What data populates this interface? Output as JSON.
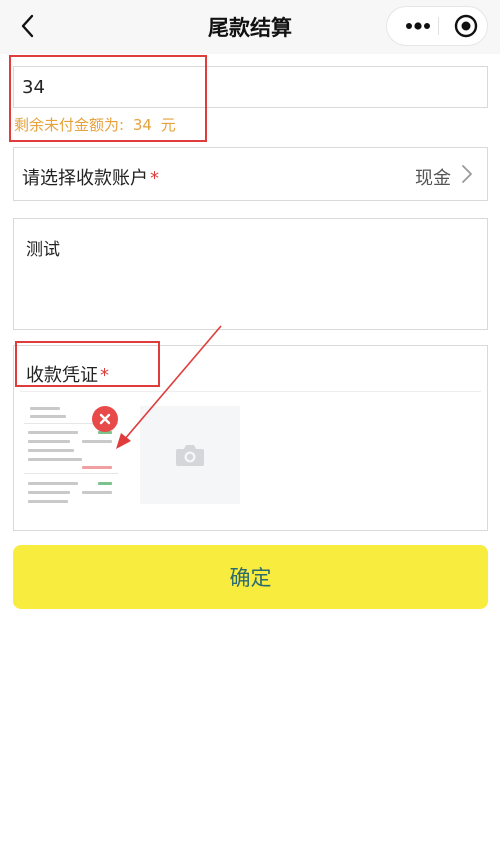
{
  "navbar": {
    "title": "尾款结算"
  },
  "amount": {
    "value": "34",
    "remaining_label": "剩余未付金额为:",
    "remaining_value": "34",
    "remaining_unit": "元"
  },
  "account": {
    "label": "请选择收款账户",
    "required_mark": "*",
    "value": "现金"
  },
  "remark": {
    "value": "测试"
  },
  "voucher": {
    "label": "收款凭证",
    "required_mark": "*"
  },
  "confirm": {
    "label": "确定"
  },
  "colors": {
    "confirm_bg": "#f8ec3e",
    "confirm_text": "#2c6b6f",
    "remaining_text": "#e6a23c",
    "required": "#e03c3c",
    "annotation": "#e03c3c"
  },
  "icons": [
    "back-arrow-icon",
    "more-dots-icon",
    "capsule-close-icon",
    "chevron-right-icon",
    "delete-icon",
    "camera-icon"
  ]
}
